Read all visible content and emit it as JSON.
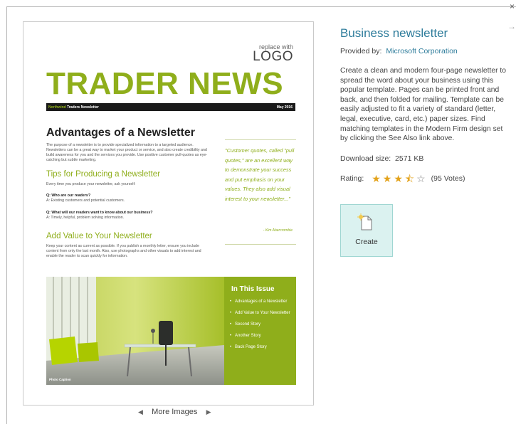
{
  "dialog": {
    "close": "×",
    "next": "→"
  },
  "preview": {
    "logo_small": "replace with",
    "logo_big": "LOGO",
    "masthead": "TRADER NEWS",
    "bar_brand": "Northwind",
    "bar_left": "Traders Newsletter",
    "bar_right": "May 2016",
    "h1": "Advantages of a Newsletter",
    "intro": "The purpose of a newsletter is to provide specialized information to a targeted audience. Newsletters can be a great way to market your product or service, and also create credibility and build awareness for you and the services you provide. Use positive customer pull-quotes as eye-catching but subtle marketing.",
    "h2_tips": "Tips for Producing a Newsletter",
    "tips_text": "Every time you produce your newsletter, ask yourself:",
    "q1": "Q:  Who are our readers?",
    "a1": "A:  Existing customers and potential customers.",
    "q2": "Q:  What will our readers want to know about our business?",
    "a2": "A:  Timely, helpful, problem solving information.",
    "h2_value": "Add Value to Your Newsletter",
    "value_text": "Keep your content as current as possible. If you publish a monthly letter, ensure you include content from only the last month. Also, use photographs and other visuals to add interest and enable the reader to scan quickly for information.",
    "quote": "\"Customer quotes, called \"pull quotes,\" are an excellent way to demonstrate your success and put emphasis on your values. They also add visual interest to your newsletter...\"",
    "quote_by": "- Kim Abercrombie",
    "photo_caption": "Photo Caption",
    "issue_title": "In This Issue",
    "issue_items": [
      "Advantages of a Newsletter",
      "Add Value to Your Newsletter",
      "Second Story",
      "Another Story",
      "Back Page Story"
    ]
  },
  "more_images": {
    "prev": "◀",
    "label": "More Images",
    "next": "▶"
  },
  "panel": {
    "title": "Business newsletter",
    "provided_label": "Provided by:",
    "provider": "Microsoft Corporation",
    "description": "Create a clean and modern four-page newsletter to spread the word about your business using this popular template. Pages can be printed front and back, and then folded for mailing. Template can be easily adjusted to fit a variety of standard (letter, legal, executive, card, etc.) paper sizes. Find matching templates in the Modern Firm design set by clicking the See Also link above.",
    "download_label": "Download size:",
    "download_size": "2571 KB",
    "rating_label": "Rating:",
    "rating_value": 3.5,
    "votes": "(95 Votes)",
    "create_label": "Create"
  },
  "colors": {
    "accent_green": "#8fae1b",
    "link_blue": "#2e7c9b",
    "create_bg": "#dbf2f0",
    "star": "#e3a21a"
  }
}
